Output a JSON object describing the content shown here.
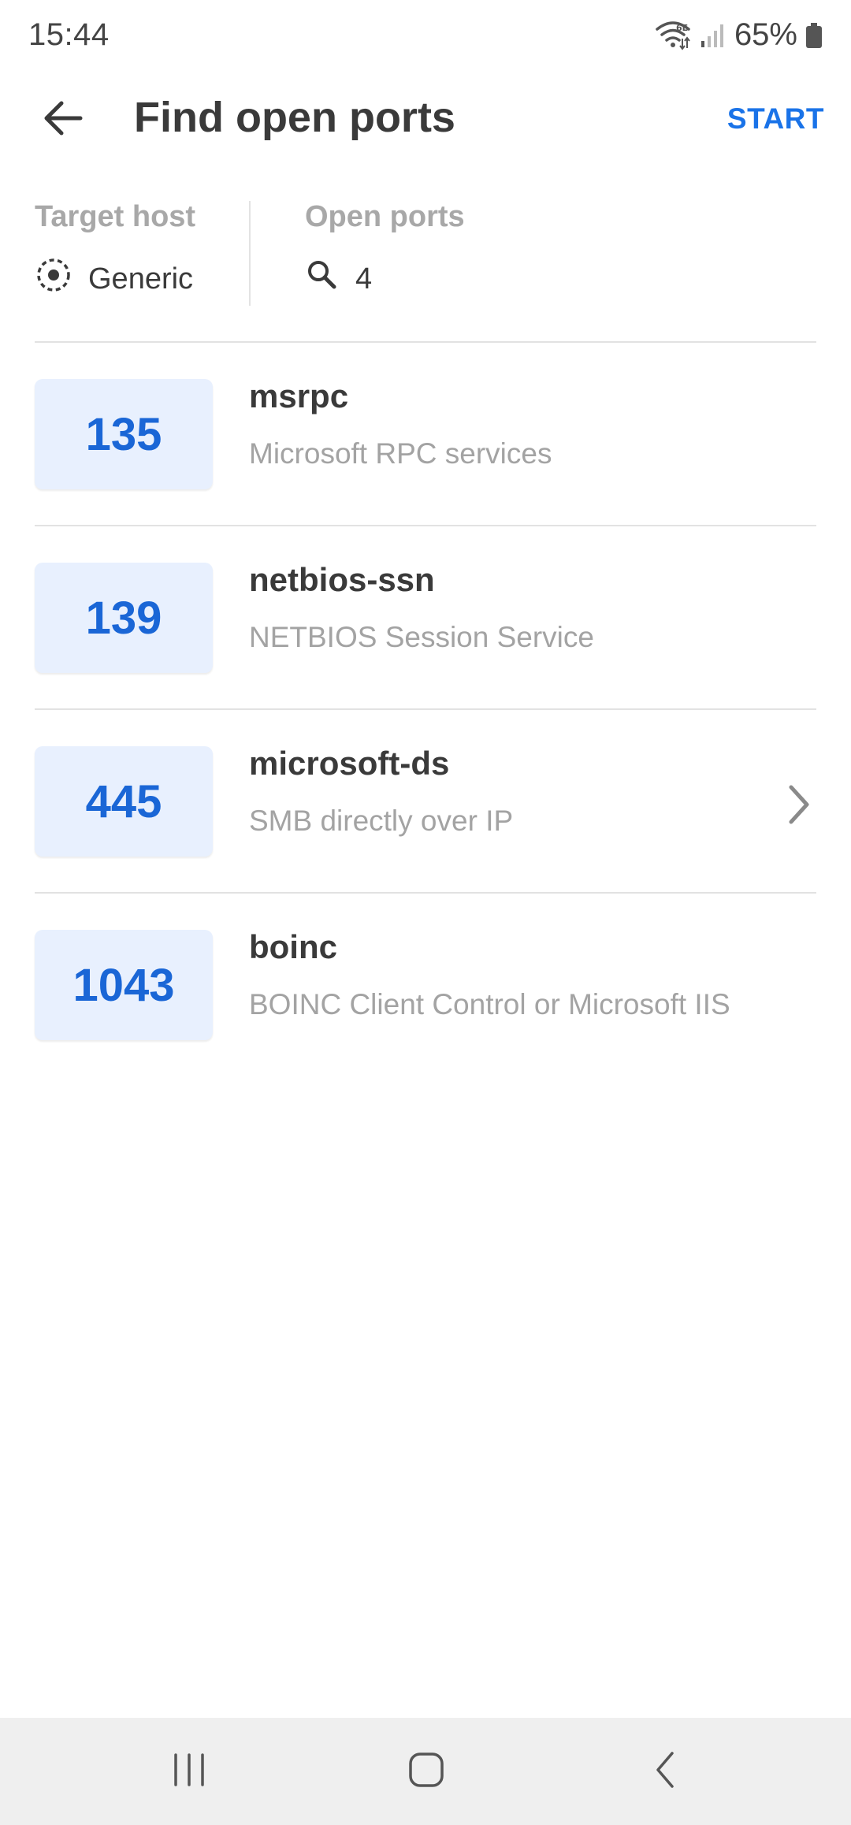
{
  "status_bar": {
    "time": "15:44",
    "battery_percent": "65%",
    "icons": [
      "wifi-6e-icon",
      "signal-icon",
      "battery-icon"
    ]
  },
  "app_bar": {
    "title": "Find open ports",
    "start_label": "START",
    "back_icon": "arrow-left-icon"
  },
  "summary": {
    "target_host_label": "Target host",
    "target_host_value": "Generic",
    "open_ports_label": "Open ports",
    "open_ports_count": "4"
  },
  "ports": [
    {
      "number": "135",
      "service": "msrpc",
      "description": "Microsoft RPC services",
      "has_chevron": false
    },
    {
      "number": "139",
      "service": "netbios-ssn",
      "description": "NETBIOS Session Service",
      "has_chevron": false
    },
    {
      "number": "445",
      "service": "microsoft-ds",
      "description": "SMB directly over IP",
      "has_chevron": true
    },
    {
      "number": "1043",
      "service": "boinc",
      "description": "BOINC Client Control or Microsoft IIS",
      "has_chevron": false
    }
  ],
  "nav_bar": {
    "icons": [
      "recent-apps-icon",
      "home-icon",
      "back-icon"
    ]
  },
  "colors": {
    "accent": "#1a73e8",
    "port_box_bg": "#e8f0fe",
    "port_number": "#1a66d6",
    "secondary_text": "#a3a3a3",
    "nav_bar_bg": "#efefef"
  }
}
